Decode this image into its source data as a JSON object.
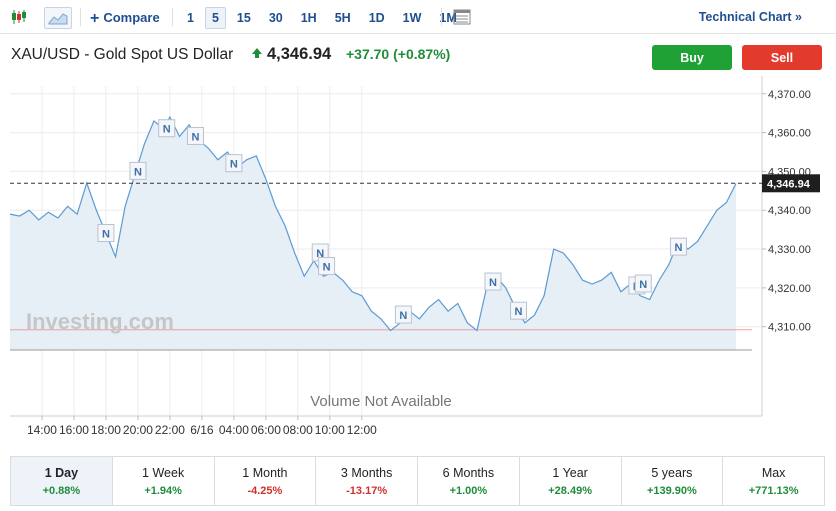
{
  "toolbar": {
    "compare_label": "Compare",
    "intervals": [
      "1",
      "5",
      "15",
      "30",
      "1H",
      "5H",
      "1D",
      "1W",
      "1M"
    ],
    "active_interval": "5",
    "technical_chart_label": "Technical Chart »"
  },
  "header": {
    "title": "XAU/USD - Gold Spot US Dollar",
    "price": "4,346.94",
    "change": "+37.70",
    "change_pct": "(+0.87%)",
    "buy_label": "Buy",
    "sell_label": "Sell"
  },
  "colors": {
    "positive": "#1f8d3a",
    "negative": "#d0312d",
    "accent": "#1f4f8f",
    "buy": "#1fa135",
    "sell": "#e23b2e",
    "line": "#5b9bd5",
    "area": "#e6eef6"
  },
  "chart_data": {
    "type": "area",
    "watermark": "Investing.com",
    "volume_note": "Volume Not Available",
    "last_price_label": "4,346.94",
    "last_price": 4346.94,
    "reference_level": 4309.2,
    "ylim": [
      4304,
      4372
    ],
    "yticks": [
      4310,
      4320,
      4330,
      4340,
      4350,
      4360,
      4370
    ],
    "ytick_labels": [
      "4,310.00",
      "4,320.00",
      "4,330.00",
      "4,340.00",
      "4,350.00",
      "4,360.00",
      "4,370.00"
    ],
    "xticks": [
      1,
      2,
      3,
      4,
      5,
      6,
      7,
      8,
      9,
      10,
      11,
      12
    ],
    "xtick_labels": [
      "14:00",
      "16:00",
      "18:00",
      "20:00",
      "22:00",
      "6/16",
      "04:00",
      "06:00",
      "08:00",
      "10:00",
      "12:00",
      ""
    ],
    "xticks_visible": [
      0,
      1,
      2,
      3,
      4,
      5,
      6,
      7,
      8,
      9,
      10
    ],
    "xlim": [
      0,
      23.2
    ],
    "series": [
      {
        "x": [
          0.0,
          0.3,
          0.6,
          0.9,
          1.2,
          1.5,
          1.8,
          2.1,
          2.4,
          2.7,
          3.0,
          3.3,
          3.6,
          3.9,
          4.2,
          4.5,
          4.8,
          5.0,
          5.3,
          5.6,
          5.9,
          6.2,
          6.5,
          6.8,
          7.1,
          7.4,
          7.7,
          8.0,
          8.3,
          8.6,
          8.9,
          9.2,
          9.5,
          9.8,
          10.1,
          10.4,
          10.7,
          11.0,
          11.3,
          11.6,
          11.9,
          12.2,
          12.5,
          12.8,
          13.1,
          13.4,
          13.7,
          14.0,
          14.3,
          14.6,
          14.9,
          15.2,
          15.5,
          15.8,
          16.1,
          16.4,
          16.7,
          17.0,
          17.3,
          17.6,
          17.9,
          18.2,
          18.5,
          18.8,
          19.1,
          19.4,
          19.7,
          20.0,
          20.3,
          20.6,
          20.9,
          21.2,
          21.5,
          21.8,
          22.1,
          22.4,
          22.7
        ],
        "y": [
          4339.0,
          4338.5,
          4340.0,
          4337.5,
          4339.5,
          4338.0,
          4341.0,
          4339.0,
          4347.0,
          4340.0,
          4334.0,
          4328.0,
          4341.0,
          4349.0,
          4357.0,
          4363.0,
          4361.0,
          4364.0,
          4359.0,
          4362.0,
          4358.0,
          4356.0,
          4353.0,
          4355.0,
          4351.0,
          4353.0,
          4354.0,
          4348.0,
          4341.0,
          4336.0,
          4329.0,
          4323.0,
          4327.0,
          4323.0,
          4324.0,
          4322.0,
          4319.0,
          4318.0,
          4314.0,
          4312.0,
          4309.0,
          4311.0,
          4314.0,
          4312.0,
          4315.0,
          4317.0,
          4314.0,
          4316.0,
          4311.0,
          4309.0,
          4320.0,
          4323.0,
          4320.0,
          4315.0,
          4311.0,
          4313.0,
          4318.0,
          4330.0,
          4329.0,
          4326.0,
          4322.0,
          4321.0,
          4322.0,
          4324.0,
          4319.0,
          4321.0,
          4318.0,
          4317.0,
          4322.0,
          4326.0,
          4332.0,
          4330.0,
          4332.0,
          4336.0,
          4340.0,
          4342.0,
          4346.9
        ]
      }
    ],
    "news_markers": [
      {
        "x": 3.0,
        "y": 4334.0,
        "label": "N"
      },
      {
        "x": 4.0,
        "y": 4350.0,
        "label": "N"
      },
      {
        "x": 4.9,
        "y": 4361.0,
        "label": "N"
      },
      {
        "x": 5.8,
        "y": 4359.0,
        "label": "N"
      },
      {
        "x": 7.0,
        "y": 4352.0,
        "label": "N"
      },
      {
        "x": 9.7,
        "y": 4329.0,
        "label": "N"
      },
      {
        "x": 9.9,
        "y": 4325.5,
        "label": "N"
      },
      {
        "x": 12.3,
        "y": 4313.0,
        "label": "N"
      },
      {
        "x": 15.1,
        "y": 4321.5,
        "label": "N"
      },
      {
        "x": 15.9,
        "y": 4314.0,
        "label": "N"
      },
      {
        "x": 19.6,
        "y": 4320.5,
        "label": "N"
      },
      {
        "x": 19.8,
        "y": 4321.0,
        "label": "N"
      },
      {
        "x": 20.9,
        "y": 4330.5,
        "label": "N"
      }
    ]
  },
  "periods": [
    {
      "label": "1 Day",
      "change": "+0.88%",
      "dir": "pos",
      "active": true
    },
    {
      "label": "1 Week",
      "change": "+1.94%",
      "dir": "pos",
      "active": false
    },
    {
      "label": "1 Month",
      "change": "-4.25%",
      "dir": "neg",
      "active": false
    },
    {
      "label": "3 Months",
      "change": "-13.17%",
      "dir": "neg",
      "active": false
    },
    {
      "label": "6 Months",
      "change": "+1.00%",
      "dir": "pos",
      "active": false
    },
    {
      "label": "1 Year",
      "change": "+28.49%",
      "dir": "pos",
      "active": false
    },
    {
      "label": "5 years",
      "change": "+139.90%",
      "dir": "pos",
      "active": false
    },
    {
      "label": "Max",
      "change": "+771.13%",
      "dir": "pos",
      "active": false
    }
  ]
}
